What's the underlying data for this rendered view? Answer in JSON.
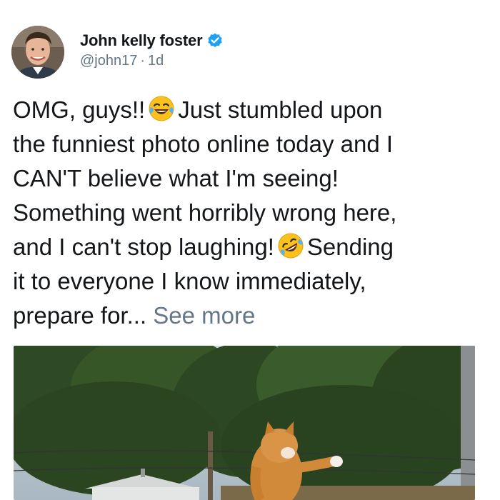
{
  "tweet": {
    "author": {
      "display_name": "John kelly foster",
      "verified": true,
      "handle": "@john17",
      "separator": "·",
      "time_ago": "1d"
    },
    "text_lines": [
      {
        "before": "OMG, guys!!",
        "emoji": "face-with-tears-of-joy",
        "after": "Just stumbled upon"
      },
      {
        "text": "the funniest photo online today and I"
      },
      {
        "text": "CAN'T believe what I'm seeing!"
      },
      {
        "text": "Something went horribly wrong here,"
      },
      {
        "before": "and I can't stop laughing!",
        "emoji": "rolling-on-the-floor-laughing",
        "after": "Sending"
      },
      {
        "text": "it to everyone I know immediately,"
      },
      {
        "before": "prepare for...",
        "link": "See more"
      }
    ],
    "media": {
      "kind": "photo",
      "subject": "cat-photo"
    }
  },
  "colors": {
    "text": "#14171a",
    "muted": "#657786",
    "verified_blue": "#1da1f2"
  }
}
